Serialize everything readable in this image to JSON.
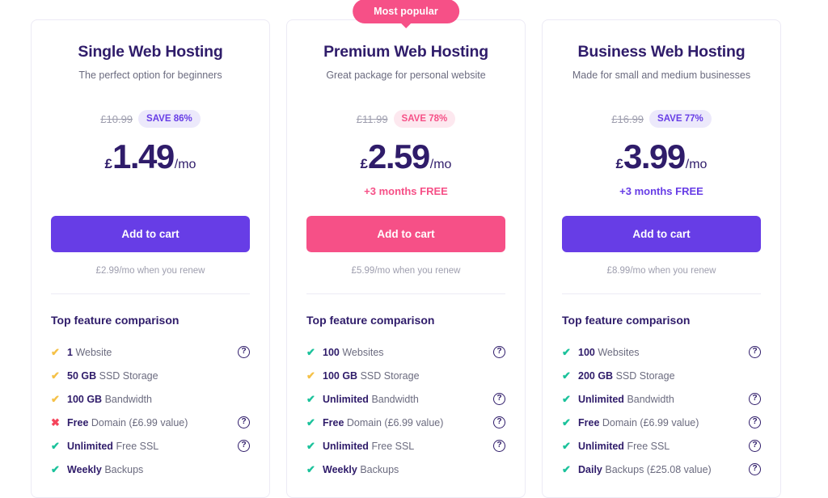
{
  "badges": {
    "most_popular": "Most popular"
  },
  "icons": {
    "check": "✔",
    "cross": "✖",
    "help": "?"
  },
  "colors": {
    "purple": "#673de6",
    "pink": "#f65087",
    "navy": "#2f1c6a",
    "green": "#1bc29b",
    "yellow": "#f5c147",
    "red": "#f5455c"
  },
  "plans": [
    {
      "title": "Single Web Hosting",
      "subtitle": "The perfect option for beginners",
      "old_price": "£10.99",
      "save_label": "SAVE 86%",
      "save_style": "purple",
      "currency": "£",
      "amount": "1.49",
      "period": "/mo",
      "bonus": "",
      "bonus_style": "empty",
      "cta_label": "Add to cart",
      "cta_style": "purple",
      "renew_note": "£2.99/mo when you renew",
      "features_title": "Top feature comparison",
      "features": [
        {
          "mark": "check",
          "mark_color": "yellow",
          "strong": "1",
          "rest": "Website",
          "help": true
        },
        {
          "mark": "check",
          "mark_color": "yellow",
          "strong": "50 GB",
          "rest": "SSD Storage",
          "help": false
        },
        {
          "mark": "check",
          "mark_color": "yellow",
          "strong": "100 GB",
          "rest": "Bandwidth",
          "help": false
        },
        {
          "mark": "cross",
          "mark_color": "red",
          "strong": "Free",
          "rest": "Domain (£6.99 value)",
          "help": true
        },
        {
          "mark": "check",
          "mark_color": "green",
          "strong": "Unlimited",
          "rest": "Free SSL",
          "help": true
        },
        {
          "mark": "check",
          "mark_color": "green",
          "strong": "Weekly",
          "rest": "Backups",
          "help": false
        }
      ]
    },
    {
      "title": "Premium Web Hosting",
      "subtitle": "Great package for personal website",
      "old_price": "£11.99",
      "save_label": "SAVE 78%",
      "save_style": "pink",
      "currency": "£",
      "amount": "2.59",
      "period": "/mo",
      "bonus": "+3 months FREE",
      "bonus_style": "pink",
      "cta_label": "Add to cart",
      "cta_style": "pink",
      "renew_note": "£5.99/mo when you renew",
      "features_title": "Top feature comparison",
      "features": [
        {
          "mark": "check",
          "mark_color": "green",
          "strong": "100",
          "rest": "Websites",
          "help": true
        },
        {
          "mark": "check",
          "mark_color": "yellow",
          "strong": "100 GB",
          "rest": "SSD Storage",
          "help": false
        },
        {
          "mark": "check",
          "mark_color": "green",
          "strong": "Unlimited",
          "rest": "Bandwidth",
          "help": true
        },
        {
          "mark": "check",
          "mark_color": "green",
          "strong": "Free",
          "rest": "Domain (£6.99 value)",
          "help": true
        },
        {
          "mark": "check",
          "mark_color": "green",
          "strong": "Unlimited",
          "rest": "Free SSL",
          "help": true
        },
        {
          "mark": "check",
          "mark_color": "green",
          "strong": "Weekly",
          "rest": "Backups",
          "help": false
        }
      ]
    },
    {
      "title": "Business Web Hosting",
      "subtitle": "Made for small and medium businesses",
      "old_price": "£16.99",
      "save_label": "SAVE 77%",
      "save_style": "purple",
      "currency": "£",
      "amount": "3.99",
      "period": "/mo",
      "bonus": "+3 months FREE",
      "bonus_style": "purple",
      "cta_label": "Add to cart",
      "cta_style": "purple",
      "renew_note": "£8.99/mo when you renew",
      "features_title": "Top feature comparison",
      "features": [
        {
          "mark": "check",
          "mark_color": "green",
          "strong": "100",
          "rest": "Websites",
          "help": true
        },
        {
          "mark": "check",
          "mark_color": "green",
          "strong": "200 GB",
          "rest": "SSD Storage",
          "help": false
        },
        {
          "mark": "check",
          "mark_color": "green",
          "strong": "Unlimited",
          "rest": "Bandwidth",
          "help": true
        },
        {
          "mark": "check",
          "mark_color": "green",
          "strong": "Free",
          "rest": "Domain (£6.99 value)",
          "help": true
        },
        {
          "mark": "check",
          "mark_color": "green",
          "strong": "Unlimited",
          "rest": "Free SSL",
          "help": true
        },
        {
          "mark": "check",
          "mark_color": "green",
          "strong": "Daily",
          "rest": "Backups (£25.08 value)",
          "help": true
        }
      ]
    }
  ]
}
